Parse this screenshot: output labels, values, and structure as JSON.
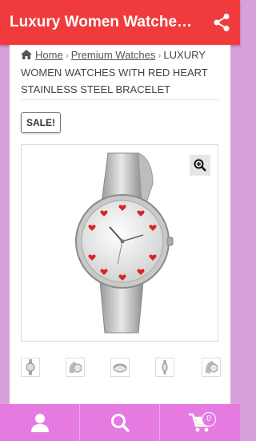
{
  "header": {
    "title": "Luxury Women Watches With Red Heart Stainless Steel Bracelet"
  },
  "breadcrumb": {
    "home": "Home",
    "category": "Premium Watches",
    "current": "LUXURY WOMEN WATCHES WITH RED HEART STAINLESS STEEL BRACELET"
  },
  "product": {
    "sale_badge": "SALE!"
  },
  "cart": {
    "count": "0"
  },
  "colors": {
    "topbar": "#ef3b3b",
    "bottombar": "#e57be0",
    "side": "#d9a1dc"
  },
  "icons": [
    "share-icon",
    "home-icon",
    "zoom-icon",
    "user-icon",
    "search-icon",
    "cart-icon"
  ]
}
